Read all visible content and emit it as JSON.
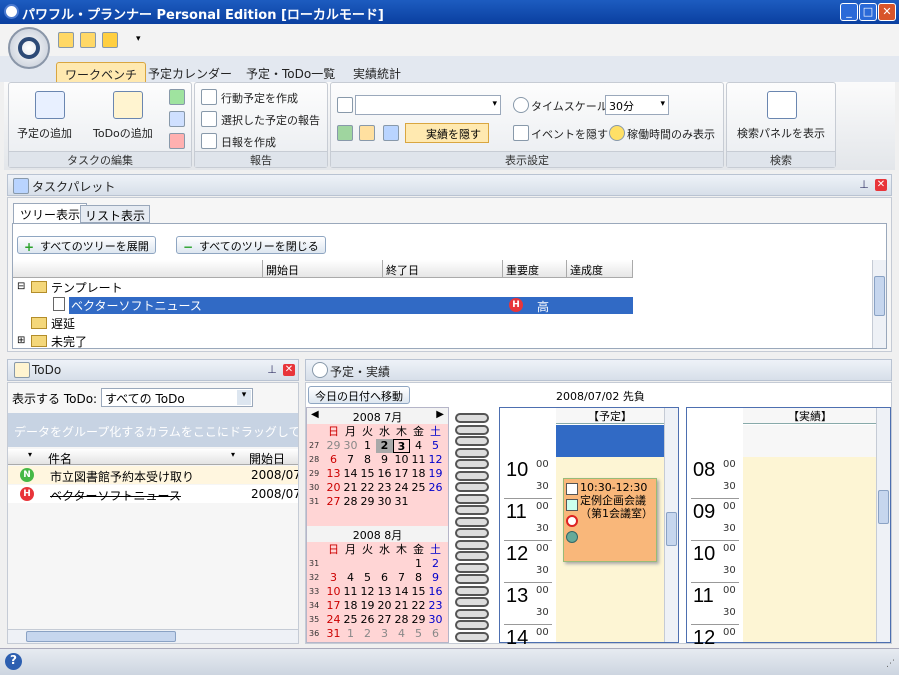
{
  "window": {
    "title": "パワフル・プランナー Personal Edition [ローカルモード]"
  },
  "ribbon_tabs": [
    "ワークベンチ",
    "予定カレンダー",
    "予定・ToDo一覧",
    "実績統計"
  ],
  "ribbon": {
    "task_edit": {
      "add_event": "予定の追加",
      "add_todo": "ToDoの追加",
      "label": "タスクの編集"
    },
    "report": {
      "items": [
        "行動予定を作成",
        "選択した予定の報告",
        "日報を作成"
      ],
      "label": "報告"
    },
    "display": {
      "combo_value": "",
      "timescale_label": "タイムスケール",
      "timescale_value": "30分",
      "hide_actual": "実績を隠す",
      "hide_event": "イベントを隠す",
      "work_time_only": "稼働時間のみ表示",
      "label": "表示設定"
    },
    "search": {
      "show_panel": "検索パネルを表示",
      "label": "検索"
    }
  },
  "task_palette": {
    "title": "タスクパレット",
    "tabs": [
      "ツリー表示",
      "リスト表示"
    ],
    "expand_all": "すべてのツリーを展開",
    "collapse_all": "すべてのツリーを閉じる",
    "columns": [
      "開始日",
      "終了日",
      "重要度",
      "達成度"
    ],
    "tree": [
      {
        "label": "テンプレート",
        "level": 0,
        "expanded": true
      },
      {
        "label": "ベクターソフトニュース",
        "level": 1,
        "selected": true,
        "priority": "高",
        "priority_icon": "H"
      },
      {
        "label": "遅延",
        "level": 0
      },
      {
        "label": "未完了",
        "level": 0,
        "collapsed": true
      }
    ]
  },
  "todo": {
    "title": "ToDo",
    "filter_label": "表示する ToDo:",
    "filter_value": "すべての ToDo",
    "group_hint": "データをグループ化するカラムをここにドラッグしてくださ",
    "columns": [
      "件名",
      "開始日"
    ],
    "rows": [
      {
        "badge": "N",
        "subject": "市立図書館予約本受け取り",
        "start": "2008/07/",
        "strike": false
      },
      {
        "badge": "H",
        "subject": "ベクターソフトニュース",
        "start": "2008/07/",
        "strike": true
      }
    ]
  },
  "schedule": {
    "title": "予定・実績",
    "goto_today": "今日の日付へ移動",
    "current_date": "2008/07/02 先負",
    "col_plan": "【予定】",
    "col_actual": "【実績】",
    "hours_plan": [
      "10",
      "11",
      "12",
      "13",
      "14"
    ],
    "hours_actual": [
      "08",
      "09",
      "10",
      "11",
      "12"
    ],
    "min_00": "00",
    "min_30": "30",
    "event": {
      "text": "10:30-12:30 定例企画会議（第1会議室）"
    }
  },
  "calendar": {
    "weekdays": [
      "日",
      "月",
      "火",
      "水",
      "木",
      "金",
      "土"
    ],
    "july": {
      "title": "2008 7月",
      "weeks": [
        {
          "wk": "27",
          "days": [
            "29",
            "30",
            "1",
            "2",
            "3",
            "4",
            "5"
          ]
        },
        {
          "wk": "28",
          "days": [
            "6",
            "7",
            "8",
            "9",
            "10",
            "11",
            "12"
          ]
        },
        {
          "wk": "29",
          "days": [
            "13",
            "14",
            "15",
            "16",
            "17",
            "18",
            "19"
          ]
        },
        {
          "wk": "30",
          "days": [
            "20",
            "21",
            "22",
            "23",
            "24",
            "25",
            "26"
          ]
        },
        {
          "wk": "31",
          "days": [
            "27",
            "28",
            "29",
            "30",
            "31",
            "",
            ""
          ]
        }
      ]
    },
    "august": {
      "title": "2008 8月",
      "weeks": [
        {
          "wk": "31",
          "days": [
            "",
            "",
            "",
            "",
            "",
            "1",
            "2"
          ]
        },
        {
          "wk": "32",
          "days": [
            "3",
            "4",
            "5",
            "6",
            "7",
            "8",
            "9"
          ]
        },
        {
          "wk": "33",
          "days": [
            "10",
            "11",
            "12",
            "13",
            "14",
            "15",
            "16"
          ]
        },
        {
          "wk": "34",
          "days": [
            "17",
            "18",
            "19",
            "20",
            "21",
            "22",
            "23"
          ]
        },
        {
          "wk": "35",
          "days": [
            "24",
            "25",
            "26",
            "27",
            "28",
            "29",
            "30"
          ]
        },
        {
          "wk": "36",
          "days": [
            "31",
            "1",
            "2",
            "3",
            "4",
            "5",
            "6"
          ]
        }
      ]
    }
  },
  "colors": {
    "title": "#0a3fa0",
    "accent": "#ffe9b0",
    "event": "#f9b77a",
    "selected": "#316ac5"
  }
}
